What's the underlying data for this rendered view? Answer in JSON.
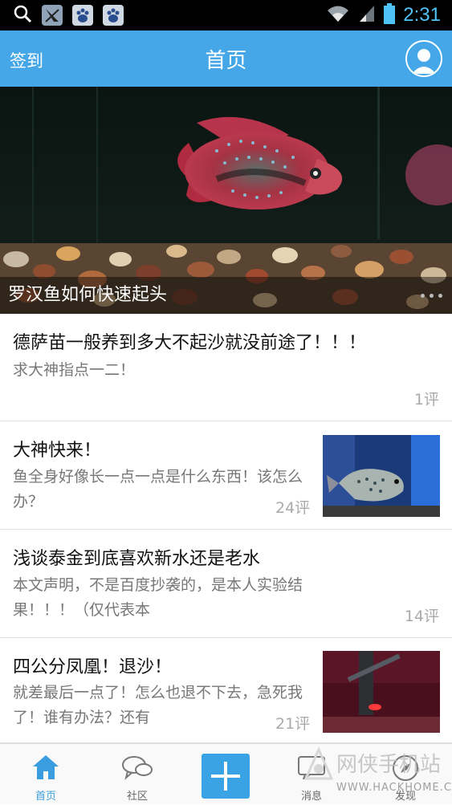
{
  "status_bar": {
    "time": "2:31",
    "icons": [
      "search-icon",
      "app-icon",
      "baidu-icon",
      "baidu-icon",
      "wifi-icon",
      "signal-icon",
      "battery-icon"
    ]
  },
  "header": {
    "left_action": "签到",
    "title": "首页",
    "avatar_icon": "user-avatar-icon"
  },
  "banner": {
    "caption": "罗汉鱼如何快速起头"
  },
  "posts": [
    {
      "title": "德萨苗一般养到多大不起沙就没前途了！！！",
      "desc": "求大神指点一二！",
      "comments": "1评"
    },
    {
      "title": "大神快来！",
      "desc": "鱼全身好像长一点一点是什么东西！该怎么办？",
      "comments": "24评"
    },
    {
      "title": "浅谈泰金到底喜欢新水还是老水",
      "desc": "本文声明，不是百度抄袭的，是本人实验结果！！！（仅代表本",
      "comments": "14评"
    },
    {
      "title": "四公分凤凰！退沙！",
      "desc": "就差最后一点了！怎么也退不下去，急死我了！谁有办法？还有",
      "comments": "21评"
    }
  ],
  "tabs": [
    {
      "label": "首页",
      "icon": "home-icon",
      "active": true
    },
    {
      "label": "社区",
      "icon": "chat-bubbles-icon",
      "active": false
    },
    {
      "label": "",
      "icon": "plus-icon",
      "active": false
    },
    {
      "label": "消息",
      "icon": "message-icon",
      "active": false
    },
    {
      "label": "发现",
      "icon": "discover-icon",
      "active": false
    }
  ],
  "watermark": {
    "text": "网侠手机站",
    "url": "WWW.HACKHOME.COM"
  },
  "colors": {
    "primary": "#45a7e8",
    "tab_active": "#3a9de0"
  }
}
